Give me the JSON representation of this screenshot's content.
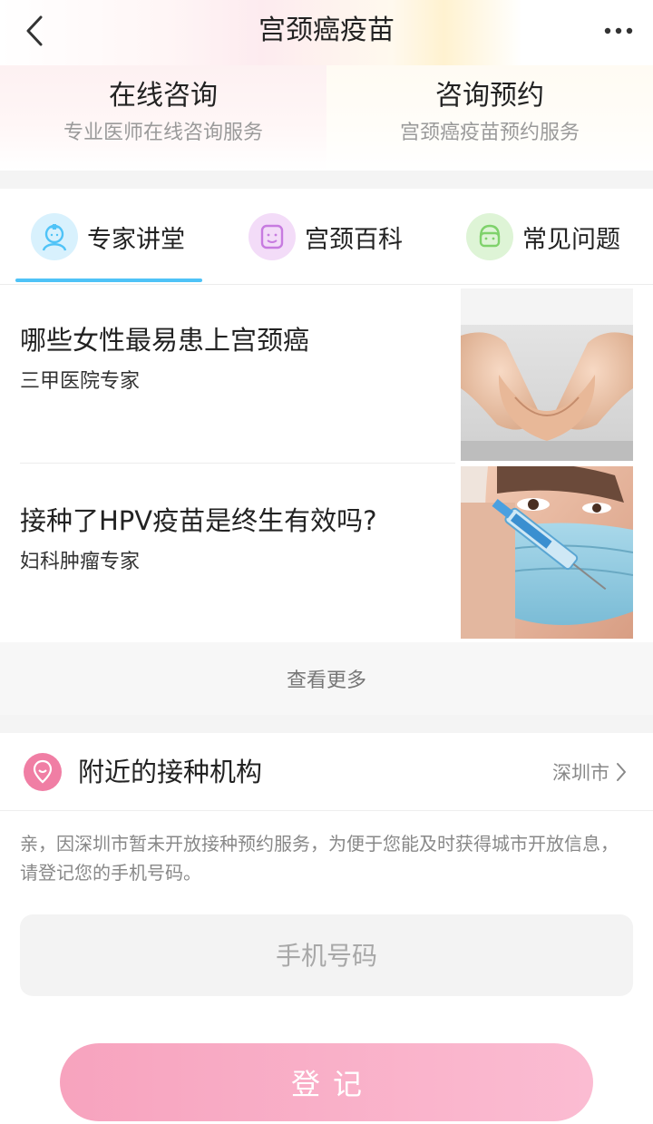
{
  "header": {
    "title": "宫颈癌疫苗",
    "back_icon": "chevron-left-icon",
    "more_icon": "more-dots-icon"
  },
  "consult": [
    {
      "title": "在线咨询",
      "subtitle": "专业医师在线咨询服务"
    },
    {
      "title": "咨询预约",
      "subtitle": "宫颈癌疫苗预约服务"
    }
  ],
  "tabs": [
    {
      "label": "专家讲堂",
      "icon": "doctor-avatar-icon",
      "color": "#4fc3f7",
      "active": true
    },
    {
      "label": "宫颈百科",
      "icon": "encyclopedia-face-icon",
      "color": "#c77be0",
      "active": false
    },
    {
      "label": "常见问题",
      "icon": "faq-face-icon",
      "color": "#7fd26b",
      "active": false
    }
  ],
  "articles": [
    {
      "title": "哪些女性最易患上宫颈癌",
      "subtitle": "三甲医院专家",
      "image": "cupped-hands-photo"
    },
    {
      "title": "接种了HPV疫苗是终生有效吗?",
      "subtitle": "妇科肿瘤专家",
      "image": "nurse-syringe-photo"
    }
  ],
  "view_more": "查看更多",
  "nearby": {
    "title": "附近的接种机构",
    "icon": "location-pin-icon",
    "city": "深圳市",
    "notice": "亲，因深圳市暂未开放接种预约服务，为便于您能及时获得城市开放信息，请登记您的手机号码。",
    "phone_placeholder": "手机号码",
    "phone_value": "",
    "register_label": "登记"
  },
  "colors": {
    "accent": "#4fc3f7",
    "pink": "#f7a3be",
    "pin": "#f07ea4"
  }
}
